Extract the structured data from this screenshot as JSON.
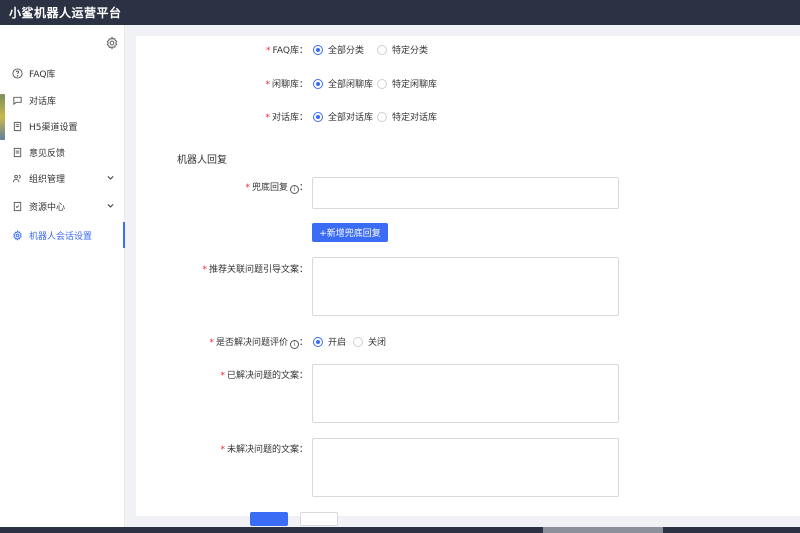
{
  "app": {
    "title": "小鲨机器人运营平台"
  },
  "sidebar": {
    "items": [
      {
        "label": "FAQ库",
        "icon": "question-circle-icon"
      },
      {
        "label": "对话库",
        "icon": "chat-icon"
      },
      {
        "label": "H5渠道设置",
        "icon": "mobile-icon"
      },
      {
        "label": "意见反馈",
        "icon": "document-icon"
      },
      {
        "label": "组织管理",
        "icon": "users-icon",
        "expandable": true
      },
      {
        "label": "资源中心",
        "icon": "folder-icon",
        "expandable": true
      },
      {
        "label": "机器人会话设置",
        "icon": "gear-icon",
        "active": true
      }
    ]
  },
  "form": {
    "faq": {
      "label": "FAQ库",
      "options": [
        "全部分类",
        "特定分类"
      ],
      "selected": "全部分类"
    },
    "chat": {
      "label": "闲聊库",
      "options": [
        "全部闲聊库",
        "特定闲聊库"
      ],
      "selected": "全部闲聊库"
    },
    "dialog": {
      "label": "对话库",
      "options": [
        "全部对话库",
        "特定对话库"
      ],
      "selected": "全部对话库"
    },
    "section_title": "机器人回复",
    "fallback": {
      "label": "兜底回复",
      "value": ""
    },
    "add_fallback_button": "+新增兜底回复",
    "recommend": {
      "label": "推荐关联问题引导文案",
      "value": ""
    },
    "evaluate": {
      "label": "是否解决问题评价",
      "options": [
        "开启",
        "关闭"
      ],
      "selected": "开启"
    },
    "solved": {
      "label": "已解决问题的文案",
      "value": ""
    },
    "unsolved": {
      "label": "未解决问题的文案",
      "value": ""
    }
  },
  "colors": {
    "accent": "#3b6cf6",
    "header": "#2b3244",
    "required": "#f5222d"
  }
}
